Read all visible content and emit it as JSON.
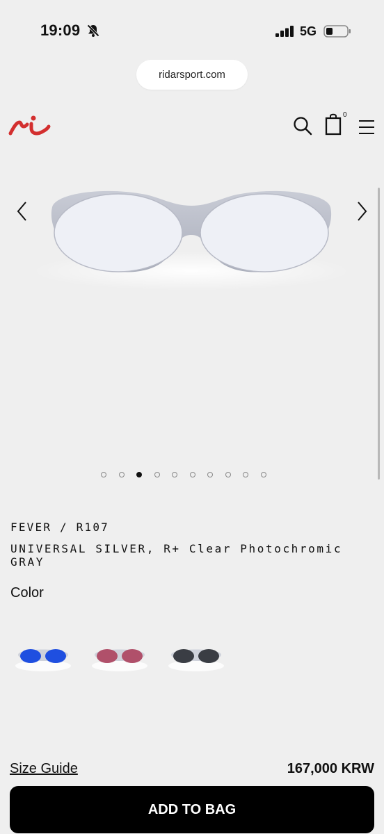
{
  "status_bar": {
    "time": "19:09",
    "network": "5G",
    "icons": [
      "bell-off-icon",
      "signal-icon",
      "battery-icon"
    ]
  },
  "browser": {
    "url": "ridarsport.com"
  },
  "header": {
    "logo": "ridar-logo",
    "bag_count": "0",
    "icons": [
      "search-icon",
      "bag-icon",
      "menu-icon"
    ]
  },
  "gallery": {
    "dot_count": 10,
    "active_index": 2,
    "icons": [
      "chevron-left-icon",
      "chevron-right-icon"
    ]
  },
  "product": {
    "name": "FEVER / R107",
    "variant": "UNIVERSAL SILVER, R+ Clear Photochromic GRAY",
    "color_label": "Color",
    "swatches": [
      {
        "lens_color": "#1f4fe0"
      },
      {
        "lens_color": "#b0506a"
      },
      {
        "lens_color": "#3a3d44"
      }
    ],
    "size_guide": "Size Guide",
    "price": "167,000 KRW",
    "add_to_bag": "ADD TO BAG"
  },
  "colors": {
    "brand": "#d32f2f",
    "button": "#000000",
    "background": "#efefef"
  }
}
